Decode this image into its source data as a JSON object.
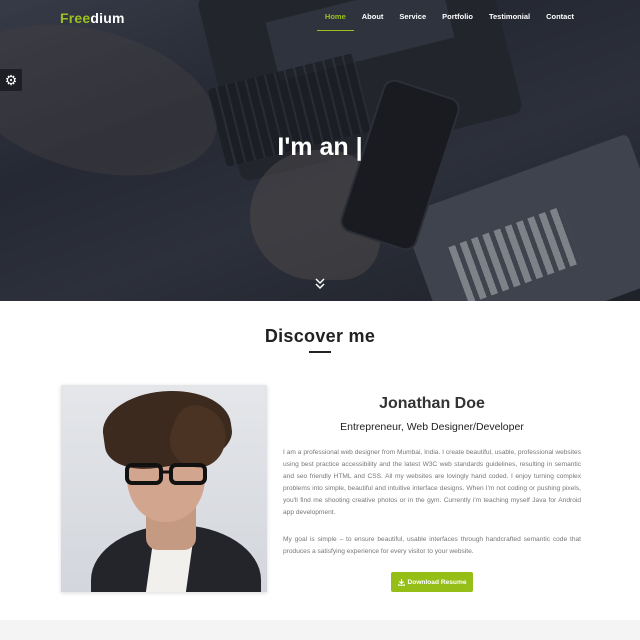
{
  "brand": {
    "part1": "Free",
    "part2": "dium"
  },
  "nav": {
    "items": [
      {
        "label": "Home",
        "active": true
      },
      {
        "label": "About",
        "active": false
      },
      {
        "label": "Service",
        "active": false
      },
      {
        "label": "Portfolio",
        "active": false
      },
      {
        "label": "Testimonial",
        "active": false
      },
      {
        "label": "Contact",
        "active": false
      }
    ]
  },
  "hero": {
    "headline": "I'm an |",
    "scroll_icon": "double-chevron-down-icon",
    "settings_icon": "gear-icon"
  },
  "about": {
    "section_title": "Discover me",
    "name": "Jonathan Doe",
    "role": "Entrepreneur, Web Designer/Developer",
    "bio_paragraph_1": "I am a professional web designer from Mumbai, India. I create beautiful, usable, professional websites using best practice accessibility and the latest W3C web standards guidelines, resulting in semantic and seo friendly HTML and CSS. All my websites are lovingly hand coded. I enjoy turning complex problems into simple, beautiful and intuitive interface designs. When I'm not coding or pushing pixels, you'll find me shooting creative photos or in the gym. Currently i'm teaching myself Java for Android app development.",
    "bio_paragraph_2": "My goal is simple – to ensure beautiful, usable interfaces through handcrafted semantic code that produces a satisfying experience for every visitor to your website.",
    "download_label": "Download Resume",
    "download_icon": "download-icon"
  },
  "colors": {
    "accent": "#9bc21c",
    "button": "#95bf17",
    "heading": "#222222",
    "body_text": "#777777"
  }
}
